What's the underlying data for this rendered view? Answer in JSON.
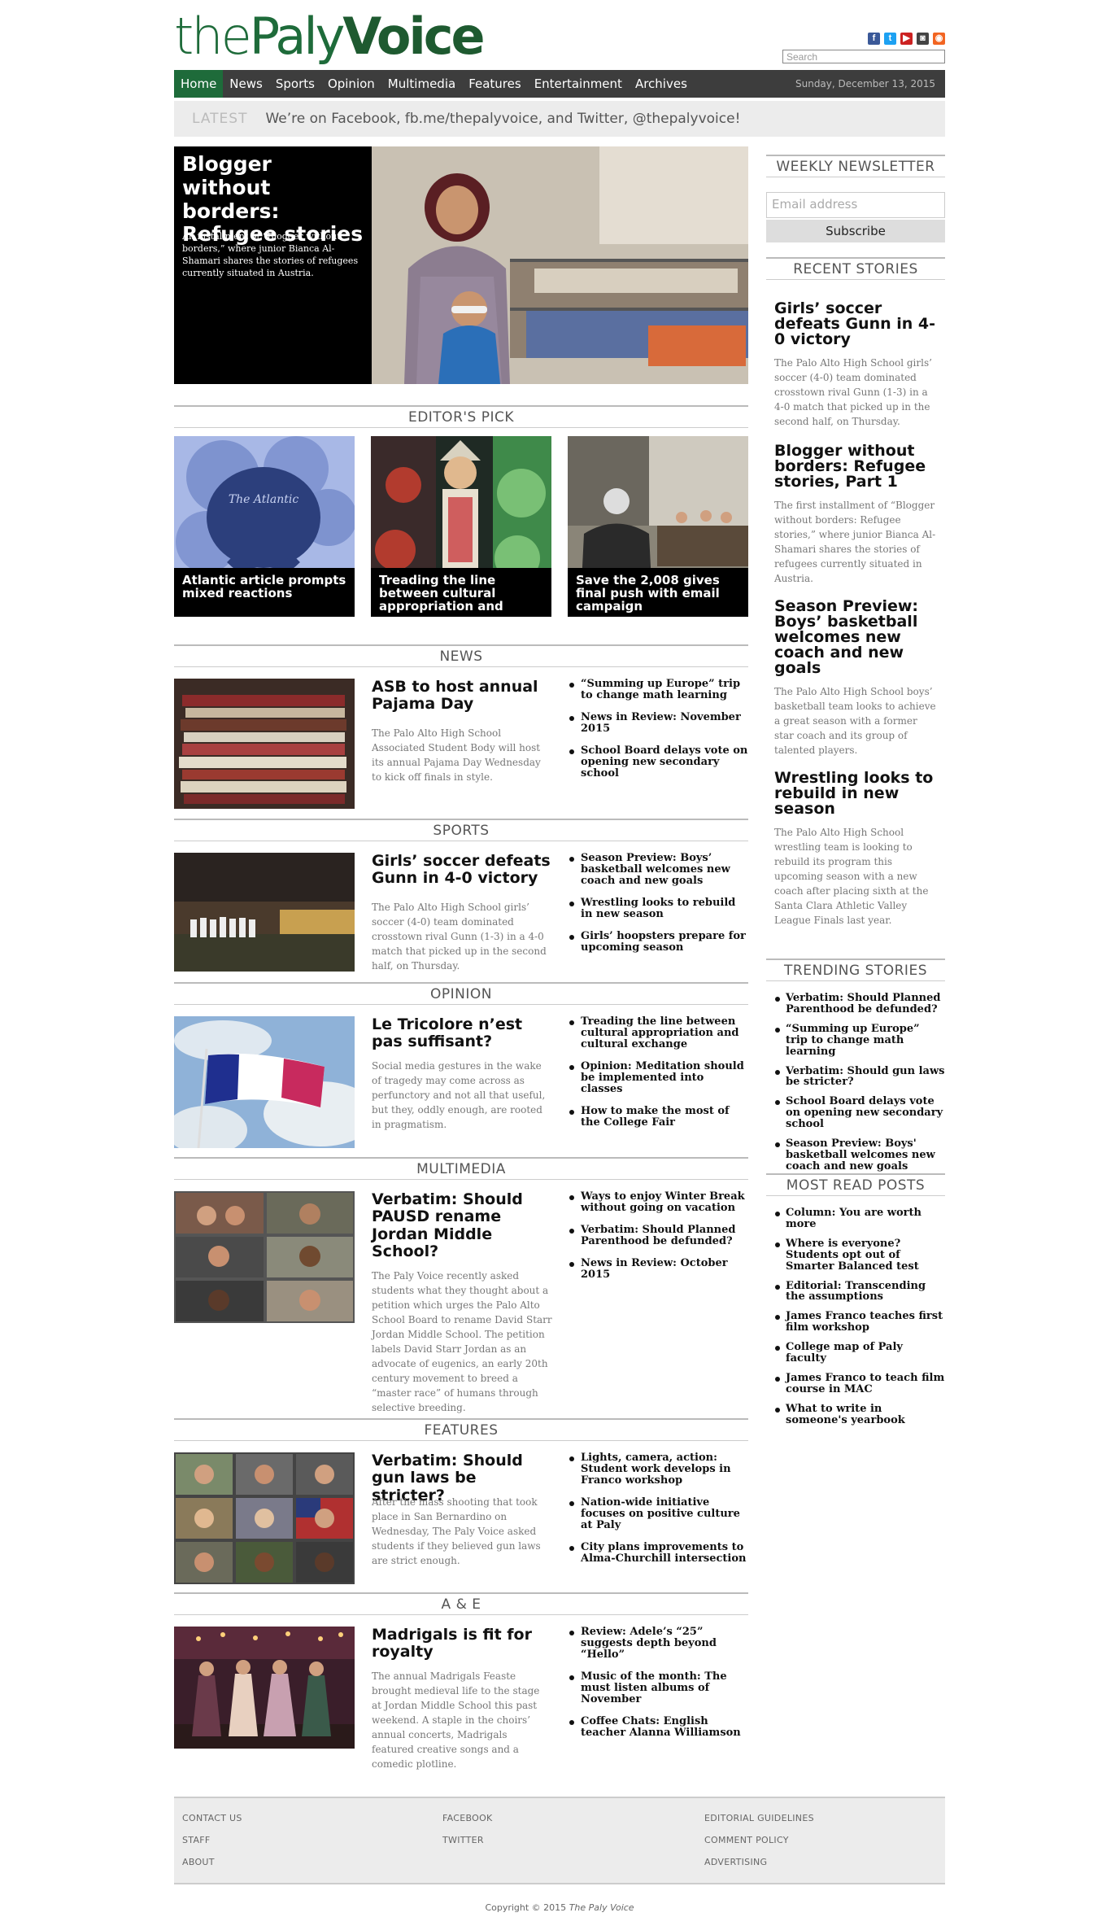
{
  "header": {
    "logo_part1": "the",
    "logo_part2": "Paly",
    "logo_part3": "Voice",
    "search_placeholder": "Search",
    "social": [
      {
        "name": "facebook-icon",
        "glyph": "f",
        "color": "#3b5998"
      },
      {
        "name": "twitter-icon",
        "glyph": "t",
        "color": "#1da1f2"
      },
      {
        "name": "youtube-icon",
        "glyph": "▶",
        "color": "#cc2222"
      },
      {
        "name": "instagram-icon",
        "glyph": "◙",
        "color": "#444444"
      },
      {
        "name": "rss-icon",
        "glyph": "◉",
        "color": "#f26522"
      }
    ]
  },
  "nav": {
    "items": [
      "Home",
      "News",
      "Sports",
      "Opinion",
      "Multimedia",
      "Features",
      "Entertainment",
      "Archives"
    ],
    "date": "Sunday, December 13, 2015"
  },
  "latest": {
    "label": "LATEST",
    "text": "We’re on Facebook, fb.me/thepalyvoice, and Twitter, @thepalyvoice!"
  },
  "hero": {
    "title": "Blogger without borders: Refugee stories",
    "description": "An installment of “Blogger without borders,” where junior Bianca Al-Shamari shares the stories of refugees currently situated in Austria."
  },
  "editors_pick": {
    "heading": "EDITOR'S PICK",
    "items": [
      {
        "caption": "Atlantic article prompts mixed reactions",
        "logo_text": "The Atlantic"
      },
      {
        "caption": "Treading the line between cultural appropriation and"
      },
      {
        "caption": "Save the 2,008 gives final push with email campaign"
      }
    ]
  },
  "sections": [
    {
      "heading": "NEWS",
      "title": "ASB to host annual Pajama Day",
      "description": "The Palo Alto High School Associated Student Body will host its annual Pajama Day Wednesday to kick off finals in style.",
      "links": [
        "“Summing up Europe” trip to change math learning",
        "News in Review: November 2015",
        "School Board delays vote on opening new secondary school"
      ]
    },
    {
      "heading": "SPORTS",
      "title": "Girls’ soccer defeats Gunn in 4-0 victory",
      "description": "The Palo Alto High School girls’ soccer (4-0) team dominated crosstown rival Gunn (1-3) in a 4-0 match that picked up in the second half, on Thursday.",
      "links": [
        "Season Preview: Boys’ basketball welcomes new coach and new goals",
        "Wrestling looks to rebuild in new season",
        "Girls’ hoopsters prepare for upcoming season"
      ]
    },
    {
      "heading": "OPINION",
      "title": "Le Tricolore n’est pas suffisant?",
      "description": "Social media gestures in the wake of tragedy may come across as perfunctory and not all that useful, but they, oddly enough, are rooted in pragmatism.",
      "links": [
        "Treading the line between cultural appropriation and cultural exchange",
        "Opinion: Meditation should be implemented into classes",
        "How to make the most of the College Fair"
      ]
    },
    {
      "heading": "MULTIMEDIA",
      "title": "Verbatim: Should PAUSD rename Jordan Middle School?",
      "description": "The Paly Voice recently asked students what they thought about a petition which urges the Palo Alto School Board to rename David Starr Jordan Middle School. The petition labels David Starr Jordan as an advocate of eugenics, an early 20th century movement to breed a “master race” of humans through selective breeding.",
      "links": [
        "Ways to enjoy Winter Break without going on vacation",
        "Verbatim: Should Planned Parenthood be defunded?",
        "News in Review: October 2015"
      ]
    },
    {
      "heading": "FEATURES",
      "title": "Verbatim: Should gun laws be stricter?",
      "description": "After the mass shooting that took place in San Bernardino on Wednesday, The Paly Voice asked students if they believed gun laws are strict enough.",
      "links": [
        "Lights, camera, action: Student work develops in Franco workshop",
        "Nation-wide initiative focuses on positive culture at Paly",
        "City plans improvements to Alma-Churchill intersection"
      ]
    },
    {
      "heading": "A & E",
      "title": "Madrigals is fit for royalty",
      "description": "The annual Madrigals Feaste brought medieval life to the stage at Jordan Middle School this past weekend. A staple in the choirs’ annual concerts, Madrigals featured creative songs and a comedic plotline.",
      "links": [
        "Review: Adele’s “25” suggests depth beyond “Hello”",
        "Music of the month: The must listen albums of November",
        "Coffee Chats: English teacher Alanna Williamson"
      ]
    }
  ],
  "sidebar": {
    "newsletter_heading": "WEEKLY NEWSLETTER",
    "email_placeholder": "Email address",
    "subscribe_label": "Subscribe",
    "recent_heading": "RECENT STORIES",
    "recent": [
      {
        "title": "Girls’ soccer defeats Gunn in 4-0 victory",
        "description": "The Palo Alto High School girls’ soccer (4-0) team dominated crosstown rival Gunn (1-3) in a 4-0 match that picked up in the second half, on Thursday."
      },
      {
        "title": "Blogger without borders: Refugee stories, Part 1",
        "description": "The first installment of “Blogger without borders: Refugee stories,” where junior Bianca Al-Shamari shares the stories of refugees currently situated in Austria."
      },
      {
        "title": "Season Preview: Boys’ basketball welcomes new coach and new goals",
        "description": "The Palo Alto High School boys’ basketball team looks to achieve a great season with a former star coach and its group of talented players."
      },
      {
        "title": "Wrestling looks to rebuild in new season",
        "description": "The Palo Alto High School wrestling team is looking to rebuild its program this upcoming season with a new coach after placing sixth at the Santa Clara Athletic Valley League Finals last year."
      }
    ],
    "trending_heading": "TRENDING STORIES",
    "trending": [
      "Verbatim: Should Planned Parenthood be defunded?",
      "“Summing up Europe” trip to change math learning",
      "Verbatim: Should gun laws be stricter?",
      "School Board delays vote on opening new secondary school",
      "Season Preview: Boys' basketball welcomes new coach and new goals"
    ],
    "most_read_heading": "MOST READ POSTS",
    "most_read": [
      "Column: You are worth more",
      "Where is everyone? Students opt out of Smarter Balanced test",
      "Editorial: Transcending the assumptions",
      "James Franco teaches first film workshop",
      "College map of Paly faculty",
      "James Franco to teach film course in MAC",
      "What to write in someone's yearbook"
    ]
  },
  "footer": {
    "col1": [
      "CONTACT US",
      "STAFF",
      "ABOUT"
    ],
    "col2": [
      "FACEBOOK",
      "TWITTER"
    ],
    "col3": [
      "EDITORIAL GUIDELINES",
      "COMMENT POLICY",
      "ADVERTISING"
    ],
    "copyright_prefix": "Copyright © 2015",
    "copyright_name": "The Paly Voice"
  }
}
